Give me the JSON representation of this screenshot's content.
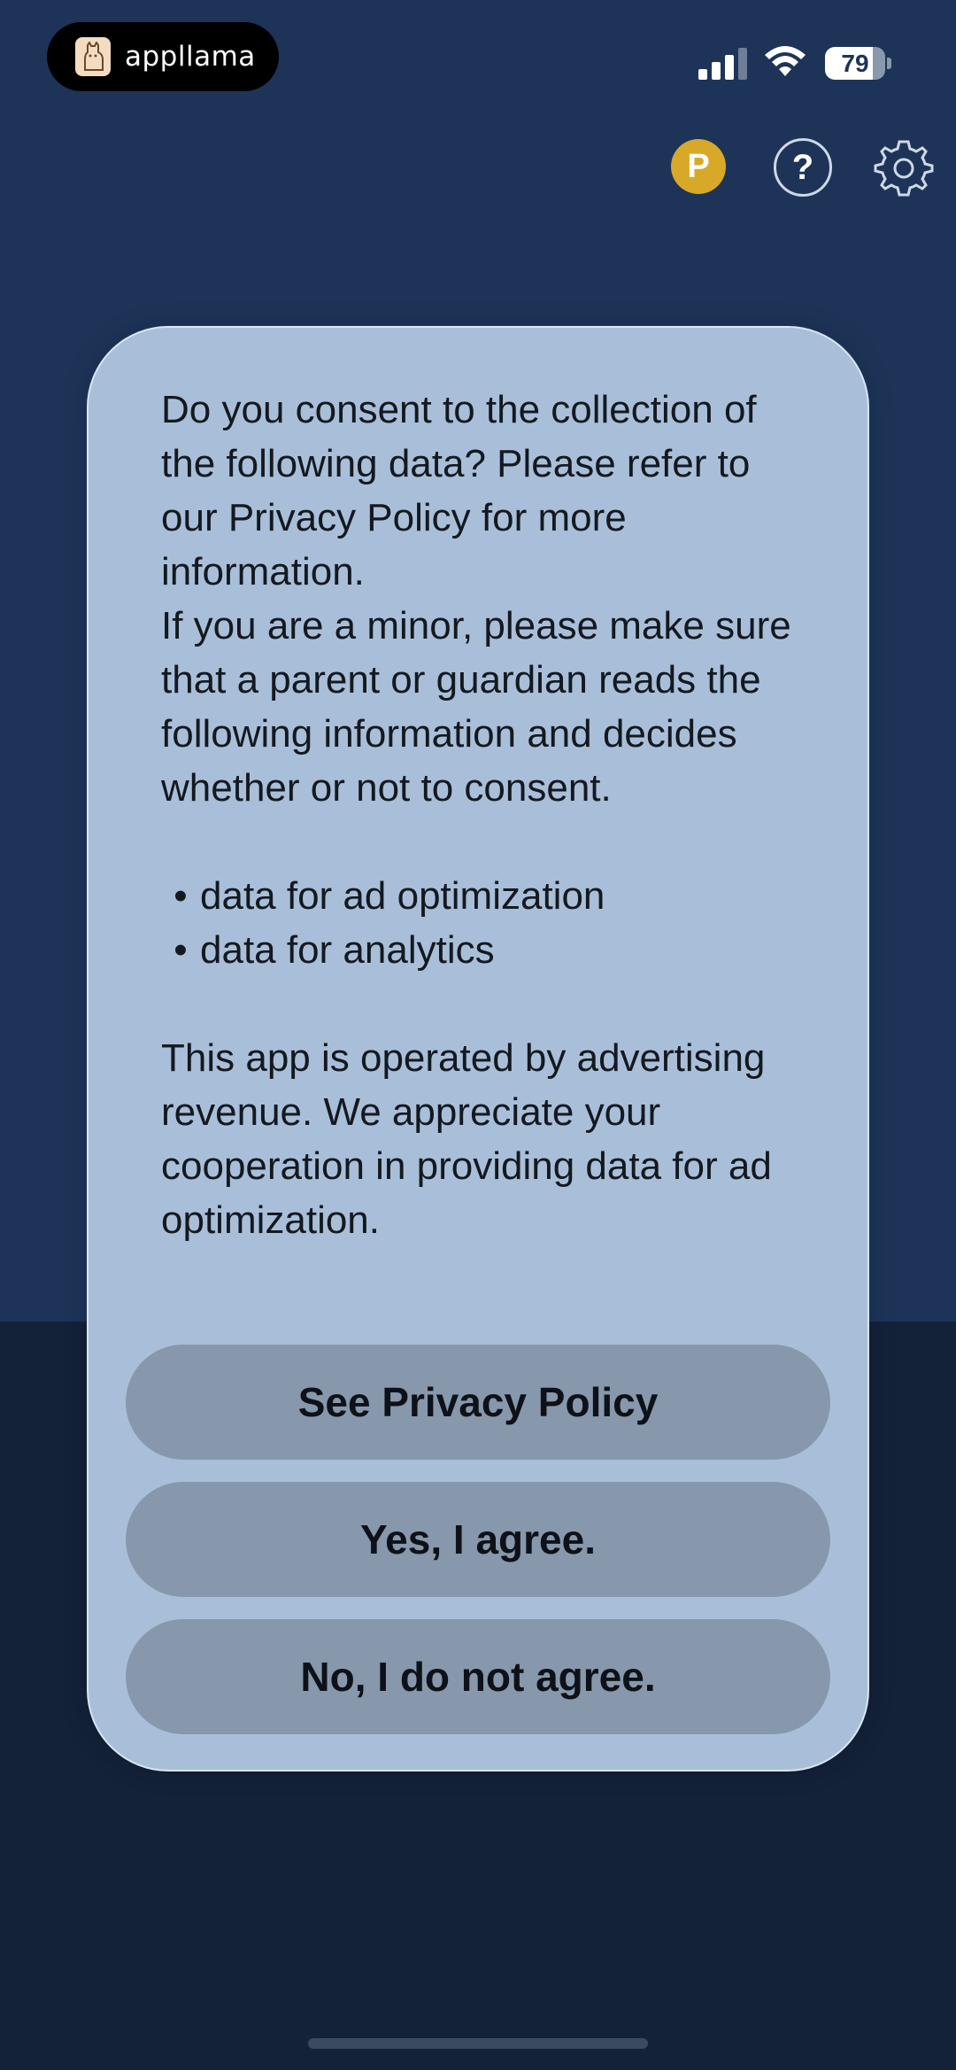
{
  "status_bar": {
    "app_name": "appllama",
    "battery_level": "79",
    "battery_fraction": 0.79,
    "icons": [
      "signal-icon",
      "wifi-icon",
      "battery-icon"
    ]
  },
  "toolbar": {
    "premium_label": "P",
    "help_label": "?",
    "premium_color": "#d8a928",
    "icons": [
      "premium-icon",
      "help-icon",
      "gear-icon"
    ]
  },
  "consent_dialog": {
    "intro": "Do you consent to the collection of the following data? Please refer to our Privacy Policy for more information.",
    "minor_notice": "If you are a minor, please make sure that a parent or guardian reads the following information and decides whether or not to consent.",
    "bullet_symbol": "•",
    "items": [
      "data for ad optimization",
      "data for analytics"
    ],
    "footer": "This app is operated by advertising revenue. We appreciate your cooperation in providing data for ad optimization.",
    "buttons": {
      "privacy_policy": "See Privacy Policy",
      "agree": "Yes, I agree.",
      "disagree": "No, I do not agree."
    }
  },
  "colors": {
    "background_top": "#1d3458",
    "background_bottom": "#132139",
    "dialog": "#a9bfd9",
    "button": "#8798ac"
  }
}
